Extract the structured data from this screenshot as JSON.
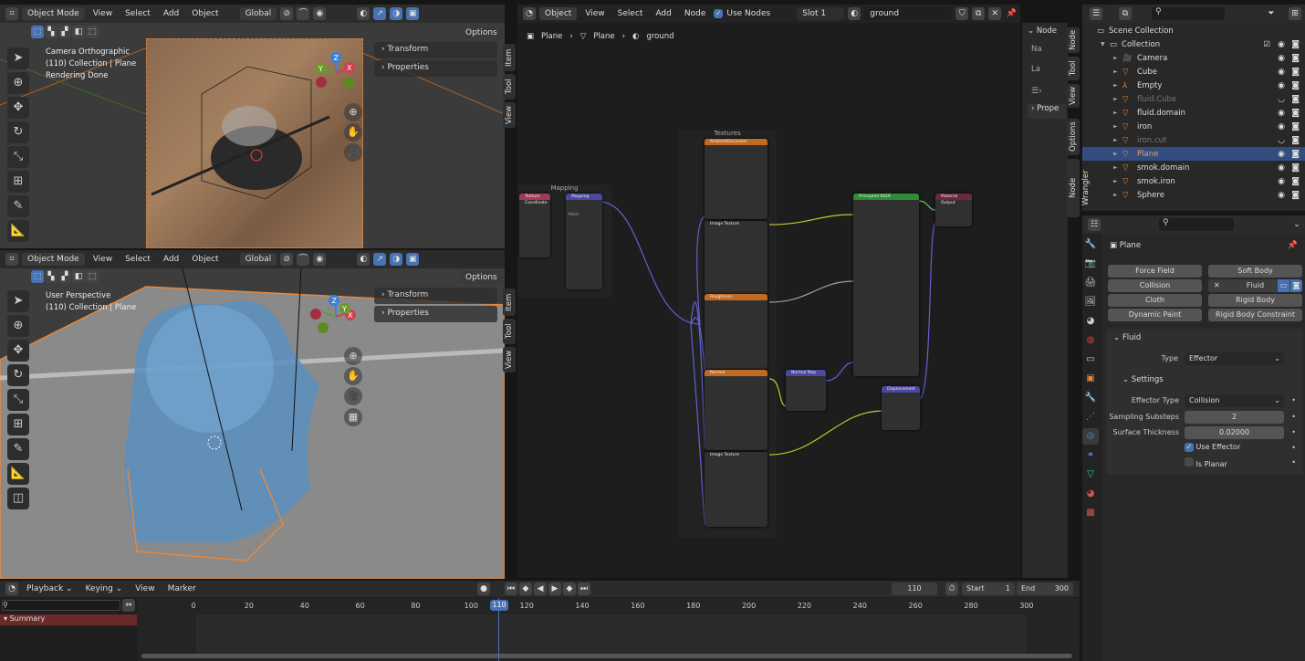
{
  "top_viewport": {
    "mode": "Object Mode",
    "menus": [
      "View",
      "Select",
      "Add",
      "Object"
    ],
    "orientation": "Global",
    "options": "Options",
    "overlay_lines": [
      "Camera Orthographic",
      "(110) Collection | Plane",
      "Rendering Done"
    ],
    "panels": [
      "Transform",
      "Properties"
    ],
    "tabs": [
      "Item",
      "Tool",
      "View"
    ]
  },
  "bottom_viewport": {
    "mode": "Object Mode",
    "menus": [
      "View",
      "Select",
      "Add",
      "Object"
    ],
    "orientation": "Global",
    "options": "Options",
    "overlay_lines": [
      "User Perspective",
      "(110) Collection | Plane"
    ],
    "panels": [
      "Transform",
      "Properties"
    ],
    "tabs": [
      "Item",
      "Tool",
      "View"
    ]
  },
  "gizmo": {
    "x": "X",
    "y": "Y",
    "z": "Z"
  },
  "node_editor": {
    "type": "Object",
    "menus": [
      "View",
      "Select",
      "Add",
      "Node"
    ],
    "use_nodes_label": "Use Nodes",
    "use_nodes": true,
    "slot": "Slot 1",
    "material": "ground",
    "breadcrumb": [
      "Plane",
      "Plane",
      "ground"
    ],
    "sidebar": {
      "section": "Node",
      "name_label": "Na",
      "label_label": "La",
      "properties": "Prope",
      "tabs": [
        "Node",
        "Tool",
        "View",
        "Options",
        "Node Wrangler"
      ]
    },
    "frames": [
      "Textures",
      "Mapping"
    ],
    "nodes": {
      "texcoord": "Texture Coordinate",
      "mapping": "Mapping",
      "mapping_type": "Point",
      "tex1": "AmbientOcclusion",
      "tex2": "Image Texture",
      "tex3": "Roughness",
      "tex4": "Normal",
      "tex5": "Image Texture",
      "bsdf": "Principled BSDF",
      "output": "Material Output",
      "normal_map": "Normal Map",
      "displacement": "Displacement"
    }
  },
  "outliner": {
    "scene_collection": "Scene Collection",
    "collection": "Collection",
    "items": [
      {
        "name": "Camera",
        "icon": "camera",
        "dim": false
      },
      {
        "name": "Cube",
        "icon": "mesh",
        "dim": false
      },
      {
        "name": "Empty",
        "icon": "empty",
        "dim": false
      },
      {
        "name": "fluid.Cube",
        "icon": "mesh",
        "dim": true
      },
      {
        "name": "fluid.domain",
        "icon": "mesh",
        "dim": false
      },
      {
        "name": "iron",
        "icon": "mesh",
        "dim": false
      },
      {
        "name": "iron.cut",
        "icon": "mesh",
        "dim": true
      },
      {
        "name": "Plane",
        "icon": "mesh",
        "dim": false,
        "selected": true
      },
      {
        "name": "smok.domain",
        "icon": "mesh",
        "dim": false
      },
      {
        "name": "smok.iron",
        "icon": "mesh",
        "dim": false
      },
      {
        "name": "Sphere",
        "icon": "mesh",
        "dim": false
      }
    ]
  },
  "properties": {
    "object": "Plane",
    "physics_buttons": [
      "Force Field",
      "Soft Body",
      "Collision",
      "Fluid",
      "Cloth",
      "Rigid Body",
      "Dynamic Paint",
      "Rigid Body Constraint"
    ],
    "fluid_panel": "Fluid",
    "type_label": "Type",
    "type_value": "Effector",
    "settings": "Settings",
    "effector_type_label": "Effector Type",
    "effector_type": "Collision",
    "substeps_label": "Sampling Substeps",
    "substeps": "2",
    "thickness_label": "Surface Thickness",
    "thickness": "0.02000",
    "use_effector_label": "Use Effector",
    "use_effector": true,
    "is_planar_label": "Is Planar",
    "is_planar": false
  },
  "timeline": {
    "menus": [
      "Playback",
      "Keying",
      "View",
      "Marker"
    ],
    "current_frame": "110",
    "start_label": "Start",
    "start": "1",
    "end_label": "End",
    "end": "300",
    "summary": "Summary",
    "ticks": [
      "0",
      "20",
      "40",
      "60",
      "80",
      "100",
      "120",
      "140",
      "160",
      "180",
      "200",
      "220",
      "240",
      "260",
      "280",
      "300"
    ],
    "playhead": 110
  },
  "colors": {
    "accent": "#4772b3",
    "selected_row": "#334d80",
    "summary": "#6b2a2a",
    "object_orange": "#e8873a"
  }
}
